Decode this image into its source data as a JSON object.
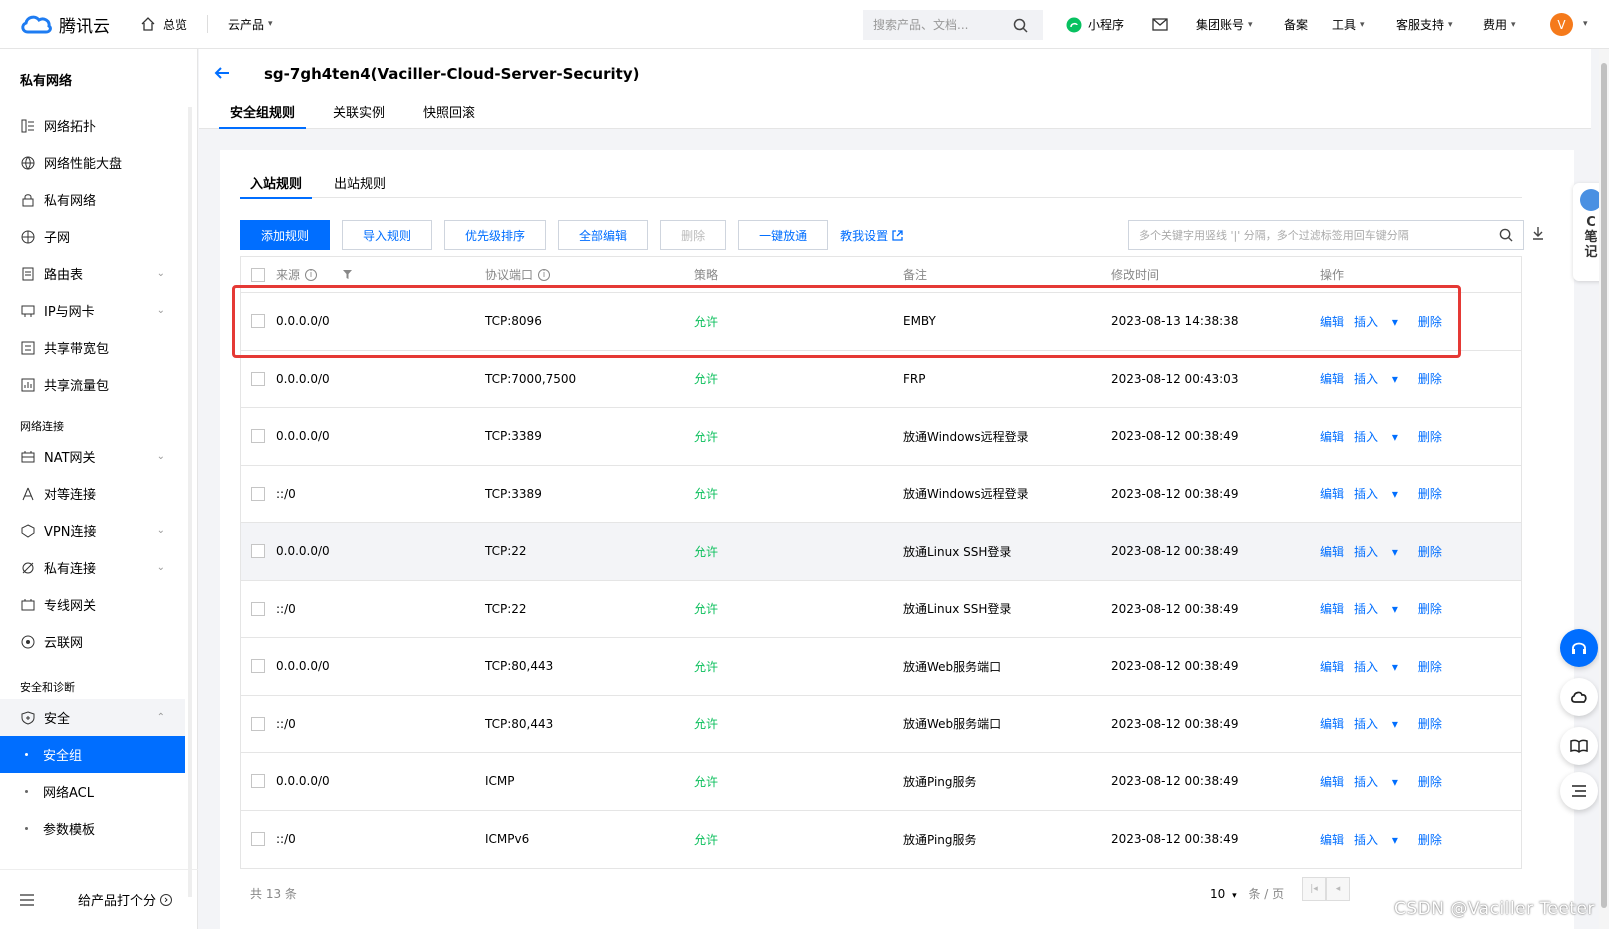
{
  "topbar": {
    "brand": "腾讯云",
    "home": "总览",
    "products": "云产品",
    "search_placeholder": "搜索产品、文档...",
    "mini_program": "小程序",
    "group_account": "集团账号",
    "filing": "备案",
    "tools": "工具",
    "support": "客服支持",
    "billing": "费用",
    "avatar_letter": "V"
  },
  "sidebar": {
    "title": "私有网络",
    "items": [
      {
        "label": "网络拓扑",
        "icon": "topology-icon"
      },
      {
        "label": "网络性能大盘",
        "icon": "globe-icon"
      },
      {
        "label": "私有网络",
        "icon": "lock-icon"
      },
      {
        "label": "子网",
        "icon": "globe-icon"
      },
      {
        "label": "路由表",
        "icon": "doc-icon",
        "expandable": true
      },
      {
        "label": "IP与网卡",
        "icon": "nic-icon",
        "expandable": true
      },
      {
        "label": "共享带宽包",
        "icon": "package-icon"
      },
      {
        "label": "共享流量包",
        "icon": "chart-icon"
      }
    ],
    "group_connect": "网络连接",
    "connect_items": [
      {
        "label": "NAT网关",
        "expandable": true
      },
      {
        "label": "对等连接"
      },
      {
        "label": "VPN连接",
        "expandable": true
      },
      {
        "label": "私有连接",
        "expandable": true
      },
      {
        "label": "专线网关"
      },
      {
        "label": "云联网"
      }
    ],
    "group_security": "安全和诊断",
    "security": "安全",
    "security_subs": [
      "安全组",
      "网络ACL",
      "参数模板"
    ],
    "footer_rate": "给产品打个分"
  },
  "header": {
    "title": "sg-7gh4ten4(Vaciller-Cloud-Server-Security)",
    "tabs": [
      "安全组规则",
      "关联实例",
      "快照回滚"
    ]
  },
  "rules": {
    "subtabs": [
      "入站规则",
      "出站规则"
    ],
    "buttons": {
      "add": "添加规则",
      "import": "导入规则",
      "sort": "优先级排序",
      "edit_all": "全部编辑",
      "delete": "删除",
      "allow_all": "一键放通",
      "teach": "教我设置"
    },
    "filter_placeholder": "多个关键字用竖线 '|' 分隔，多个过滤标签用回车键分隔",
    "columns": [
      "来源",
      "协议端口",
      "策略",
      "备注",
      "修改时间",
      "操作"
    ],
    "ops": {
      "edit": "编辑",
      "insert": "插入",
      "delete": "删除"
    },
    "rows": [
      {
        "source": "0.0.0.0/0",
        "proto": "TCP:8096",
        "policy": "允许",
        "note": "EMBY",
        "time": "2023-08-13 14:38:38"
      },
      {
        "source": "0.0.0.0/0",
        "proto": "TCP:7000,7500",
        "policy": "允许",
        "note": "FRP",
        "time": "2023-08-12 00:43:03"
      },
      {
        "source": "0.0.0.0/0",
        "proto": "TCP:3389",
        "policy": "允许",
        "note": "放通Windows远程登录",
        "time": "2023-08-12 00:38:49"
      },
      {
        "source": "::/0",
        "proto": "TCP:3389",
        "policy": "允许",
        "note": "放通Windows远程登录",
        "time": "2023-08-12 00:38:49"
      },
      {
        "source": "0.0.0.0/0",
        "proto": "TCP:22",
        "policy": "允许",
        "note": "放通Linux SSH登录",
        "time": "2023-08-12 00:38:49"
      },
      {
        "source": "::/0",
        "proto": "TCP:22",
        "policy": "允许",
        "note": "放通Linux SSH登录",
        "time": "2023-08-12 00:38:49"
      },
      {
        "source": "0.0.0.0/0",
        "proto": "TCP:80,443",
        "policy": "允许",
        "note": "放通Web服务端口",
        "time": "2023-08-12 00:38:49"
      },
      {
        "source": "::/0",
        "proto": "TCP:80,443",
        "policy": "允许",
        "note": "放通Web服务端口",
        "time": "2023-08-12 00:38:49"
      },
      {
        "source": "0.0.0.0/0",
        "proto": "ICMP",
        "policy": "允许",
        "note": "放通Ping服务",
        "time": "2023-08-12 00:38:49"
      },
      {
        "source": "::/0",
        "proto": "ICMPv6",
        "policy": "允许",
        "note": "放通Ping服务",
        "time": "2023-08-12 00:38:49"
      }
    ],
    "pager": {
      "total": "共 13 条",
      "page_size": "10",
      "page_size_unit": "条 / 页"
    }
  },
  "float": {
    "note_label": "C\n笔\n记"
  },
  "watermark": "CSDN @Vaciller Teeter",
  "colors": {
    "primary": "#006eff",
    "allow": "#0abf5b",
    "highlight": "#e53935"
  }
}
